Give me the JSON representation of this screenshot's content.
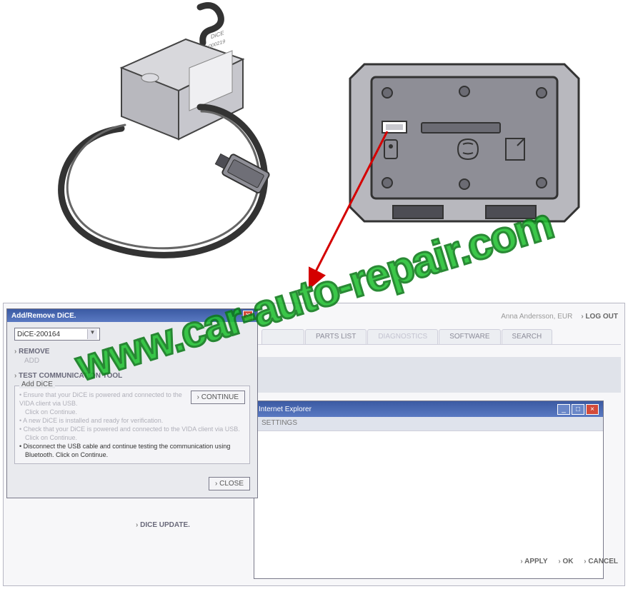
{
  "watermark": "www.car-auto-repair.com",
  "illustrations": {
    "left_device_label_top": "DiCE",
    "left_device_label_sub": "000219"
  },
  "dialog": {
    "title": "Add/Remove DiCE.",
    "combo_value": "DiCE-200164",
    "section_remove": "REMOVE",
    "sub_add": "ADD",
    "section_test": "TEST COMMUNICATION TOOL",
    "panel_title": "Add DiCE",
    "panel_line1": "Ensure that your DiCE is powered and connected to the VIDA client via USB.",
    "panel_line1b": "Click on Continue.",
    "panel_line2": "A new DiCE is installed and ready for verification.",
    "panel_line3": "Check that your DiCE is powered and connected to the VIDA client via USB.",
    "panel_line3b": "Click on Continue.",
    "panel_line4a": "Disconnect the USB cable and continue testing the communication using",
    "panel_line4b": "Bluetooth. Click on Continue.",
    "continue_btn": "› CONTINUE",
    "close_btn": "› CLOSE"
  },
  "header": {
    "user": "Anna Andersson, EUR",
    "logout": "LOG OUT"
  },
  "tabs": {
    "t1": "",
    "t2": "PARTS LIST",
    "t3": "DIAGNOSTICS",
    "t4": "SOFTWARE",
    "t5": "SEARCH"
  },
  "subwin": {
    "title": "Internet Explorer",
    "toolbar": "SETTINGS"
  },
  "lower": {
    "dice_update": "DICE UPDATE.",
    "apply": "APPLY",
    "ok": "OK",
    "cancel": "CANCEL"
  }
}
